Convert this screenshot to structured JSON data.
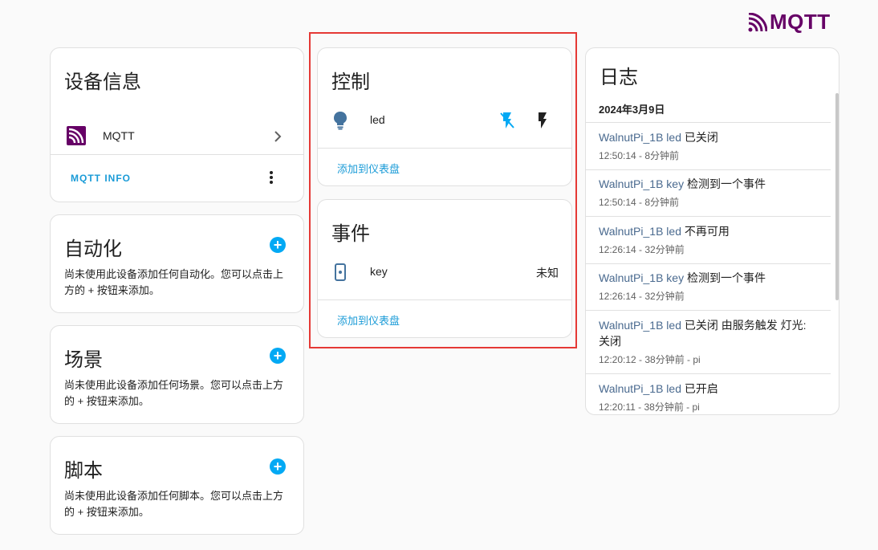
{
  "brand": {
    "logo_text": "MQTT",
    "color": "#660066"
  },
  "device_info": {
    "title": "设备信息",
    "integration_label": "MQTT",
    "info_button": "MQTT INFO"
  },
  "automation": {
    "title": "自动化",
    "description": "尚未使用此设备添加任何自动化。您可以点击上方的 + 按钮来添加。"
  },
  "scene": {
    "title": "场景",
    "description": "尚未使用此设备添加任何场景。您可以点击上方的 + 按钮来添加。"
  },
  "script": {
    "title": "脚本",
    "description": "尚未使用此设备添加任何脚本。您可以点击上方的 + 按钮来添加。"
  },
  "controls": {
    "title": "控制",
    "entity_name": "led",
    "icon": "lightbulb-icon",
    "actions": [
      "flash-off-icon",
      "flash-icon"
    ],
    "add_to_dashboard": "添加到仪表盘"
  },
  "events": {
    "title": "事件",
    "entity_name": "key",
    "icon": "remote-icon",
    "state": "未知",
    "add_to_dashboard": "添加到仪表盘"
  },
  "logbook": {
    "title": "日志",
    "date": "2024年3月9日",
    "entries": [
      {
        "entity": "WalnutPi_1B led",
        "message": "已关闭",
        "meta": "12:50:14 - 8分钟前"
      },
      {
        "entity": "WalnutPi_1B key",
        "message": "检测到一个事件",
        "meta": "12:50:14 - 8分钟前"
      },
      {
        "entity": "WalnutPi_1B led",
        "message": "不再可用",
        "meta": "12:26:14 - 32分钟前"
      },
      {
        "entity": "WalnutPi_1B key",
        "message": "检测到一个事件",
        "meta": "12:26:14 - 32分钟前"
      },
      {
        "entity": "WalnutPi_1B led",
        "message": "已关闭 由服务触发 灯光: 关闭",
        "meta": "12:20:12 - 38分钟前 - pi"
      },
      {
        "entity": "WalnutPi_1B led",
        "message": "已开启",
        "meta": "12:20:11 - 38分钟前 - pi"
      }
    ]
  }
}
